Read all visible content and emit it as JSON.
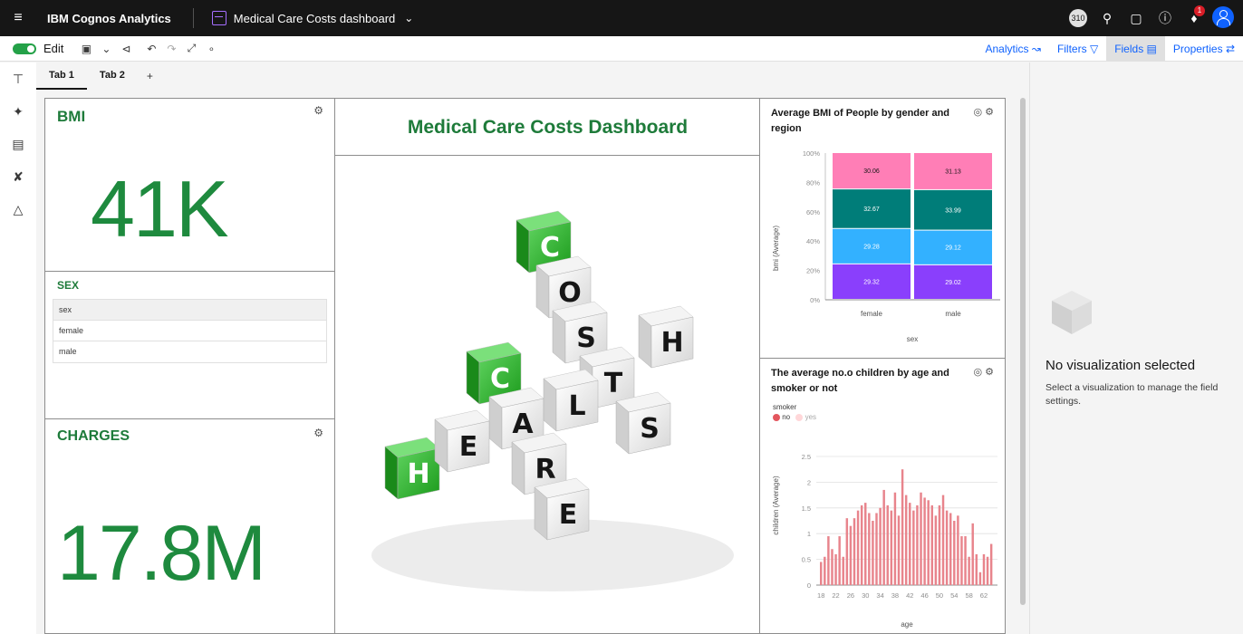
{
  "topbar": {
    "brand_prefix": "IBM",
    "brand_name": "Cognos Analytics",
    "dashboard_title": "Medical Care Costs dashboard",
    "avatar_count": "310",
    "notif_count": "1"
  },
  "toolbar": {
    "edit_label": "Edit",
    "analytics": "Analytics",
    "filters": "Filters",
    "fields": "Fields",
    "properties": "Properties"
  },
  "tabs": [
    {
      "label": "Tab 1"
    },
    {
      "label": "Tab 2"
    }
  ],
  "tab_add": "+",
  "bmi": {
    "title": "BMI",
    "value": "41K"
  },
  "sex": {
    "title": "SEX",
    "rows": [
      "sex",
      "female",
      "male"
    ]
  },
  "charges": {
    "title": "CHARGES",
    "value": "17.8M"
  },
  "dashboard": {
    "title": "Medical Care Costs Dashboard"
  },
  "bmi_chart": {
    "title_line1": "Average BMI of People by gender and",
    "title_line2": "region",
    "ylabel": "bmi (Average)",
    "xlabel": "sex",
    "yticks": [
      "100%",
      "80%",
      "60%",
      "40%",
      "20%",
      "0%"
    ]
  },
  "children_chart": {
    "title_line1": "The average no.o children by age and",
    "title_line2": "smoker or not",
    "legend_title": "smoker",
    "legend_no": "no",
    "legend_yes": "yes",
    "ylabel": "children (Average)",
    "xlabel": "age",
    "yticks": [
      "2.5",
      "2",
      "1.5",
      "1",
      "0.5",
      "0"
    ]
  },
  "side": {
    "heading": "No visualization selected",
    "text": "Select a visualization to manage the field settings."
  },
  "colors": {
    "accent": "#1e8a3e",
    "seg1": "#ff7eb6",
    "seg2": "#007d79",
    "seg3": "#33b1ff",
    "seg4": "#8a3ffc",
    "bar": "#e8848c"
  },
  "chart_data": [
    {
      "type": "bar",
      "stacked": "100%",
      "categories": [
        "female",
        "male"
      ],
      "series": [
        {
          "values": [
            29.32,
            29.02
          ],
          "color": "#8a3ffc"
        },
        {
          "values": [
            29.28,
            29.12
          ],
          "color": "#33b1ff"
        },
        {
          "values": [
            32.67,
            33.99
          ],
          "color": "#007d79"
        },
        {
          "values": [
            30.06,
            31.13
          ],
          "color": "#ff7eb6"
        }
      ],
      "xlabel": "sex",
      "ylabel": "bmi (Average)"
    },
    {
      "type": "bar",
      "x": [
        18,
        19,
        20,
        21,
        22,
        23,
        24,
        25,
        26,
        27,
        28,
        29,
        30,
        31,
        32,
        33,
        34,
        35,
        36,
        37,
        38,
        39,
        40,
        41,
        42,
        43,
        44,
        45,
        46,
        47,
        48,
        49,
        50,
        51,
        52,
        53,
        54,
        55,
        56,
        57,
        58,
        59,
        60,
        61,
        62,
        63,
        64
      ],
      "values": [
        0.45,
        0.55,
        0.95,
        0.7,
        0.6,
        0.95,
        0.55,
        1.3,
        1.15,
        1.3,
        1.45,
        1.55,
        1.6,
        1.4,
        1.25,
        1.4,
        1.5,
        1.85,
        1.55,
        1.45,
        1.8,
        1.35,
        2.25,
        1.75,
        1.6,
        1.45,
        1.55,
        1.8,
        1.7,
        1.65,
        1.55,
        1.35,
        1.55,
        1.75,
        1.45,
        1.4,
        1.25,
        1.35,
        0.95,
        0.95,
        0.55,
        1.2,
        0.6,
        0.25,
        0.6,
        0.55,
        0.8
      ],
      "ylim": [
        0,
        2.5
      ],
      "xticks": [
        "18",
        "22",
        "26",
        "30",
        "34",
        "38",
        "42",
        "46",
        "50",
        "54",
        "58",
        "62"
      ],
      "legend": [
        "no",
        "yes"
      ],
      "xlabel": "age",
      "ylabel": "children (Average)"
    }
  ]
}
